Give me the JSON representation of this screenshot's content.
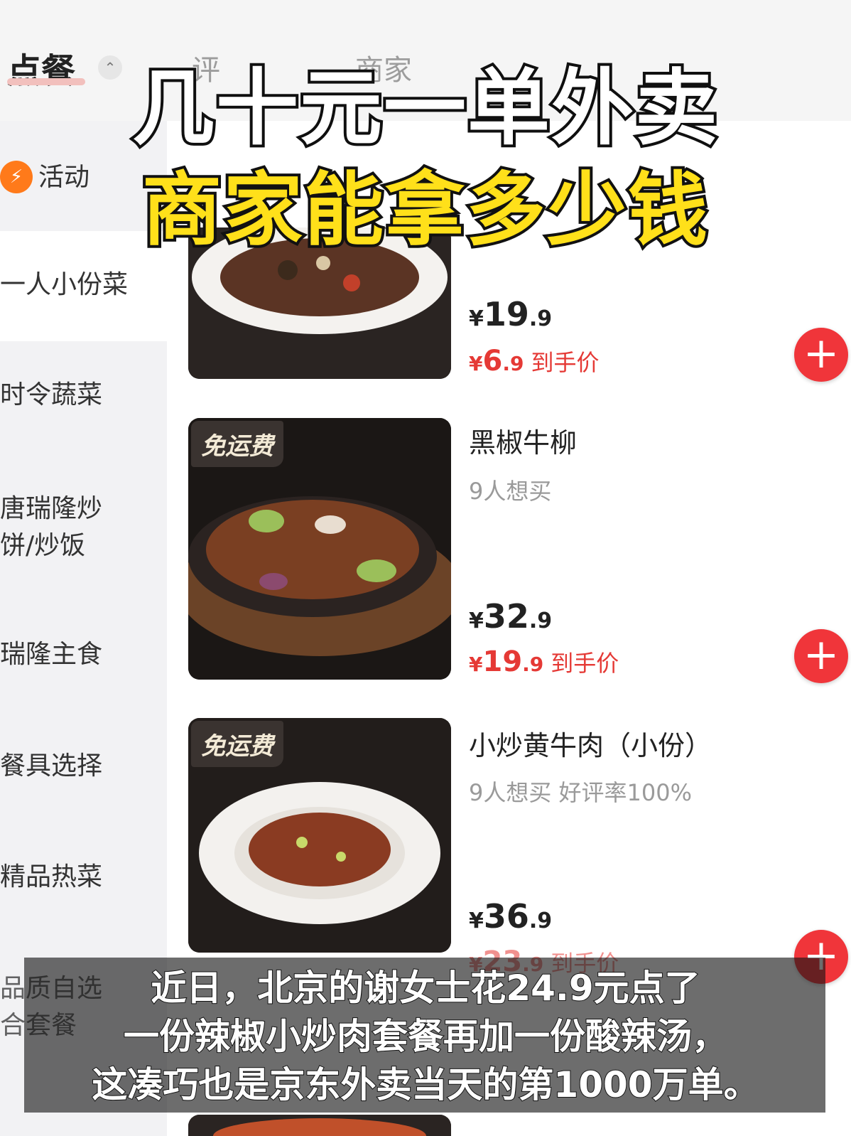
{
  "header": {
    "tab_order": "点餐",
    "collapse_symbol": "⌃",
    "tab_reviews_partial": "评",
    "tab_merchant_partial": "商家"
  },
  "headline": {
    "line1": "几十元一单外卖",
    "line2": "商家能拿多少钱"
  },
  "sidebar": {
    "items": [
      {
        "label": "活动",
        "icon": "promo-icon"
      },
      {
        "label": "一人小份菜"
      },
      {
        "label": "时令蔬菜"
      },
      {
        "label": "唐瑞隆炒饼/炒饭"
      },
      {
        "label": "瑞隆主食"
      },
      {
        "label": "餐具选择"
      },
      {
        "label": "精品热菜"
      },
      {
        "label": "品质自选合套餐"
      }
    ]
  },
  "dishes": [
    {
      "name": "",
      "meta": "",
      "badge": "",
      "price_yen": "¥",
      "price_int": "19",
      "price_dec": ".9",
      "deal_yen": "¥",
      "deal_int": "6",
      "deal_dec": ".9",
      "deal_tag": "到手价"
    },
    {
      "name": "黑椒牛柳",
      "meta": "9人想买",
      "badge": "免运费",
      "price_yen": "¥",
      "price_int": "32",
      "price_dec": ".9",
      "deal_yen": "¥",
      "deal_int": "19",
      "deal_dec": ".9",
      "deal_tag": "到手价"
    },
    {
      "name": "小炒黄牛肉（小份）",
      "meta": "9人想买  好评率100%",
      "badge": "免运费",
      "price_yen": "¥",
      "price_int": "36",
      "price_dec": ".9",
      "deal_yen": "¥",
      "deal_int": "23",
      "deal_dec": ".9",
      "deal_tag": "到手价"
    }
  ],
  "add_button_symbol": "+",
  "subtitle": {
    "line1": "近日，北京的谢女士花24.9元点了",
    "line2": "一份辣椒小炒肉套餐再加一份酸辣汤，",
    "line3": "这凑巧也是京东外卖当天的第1000万单。"
  },
  "colors": {
    "accent_red": "#f0353a",
    "deal_red": "#e53935",
    "headline_yellow": "#ffe01a",
    "promo_orange": "#ff7a1a"
  }
}
